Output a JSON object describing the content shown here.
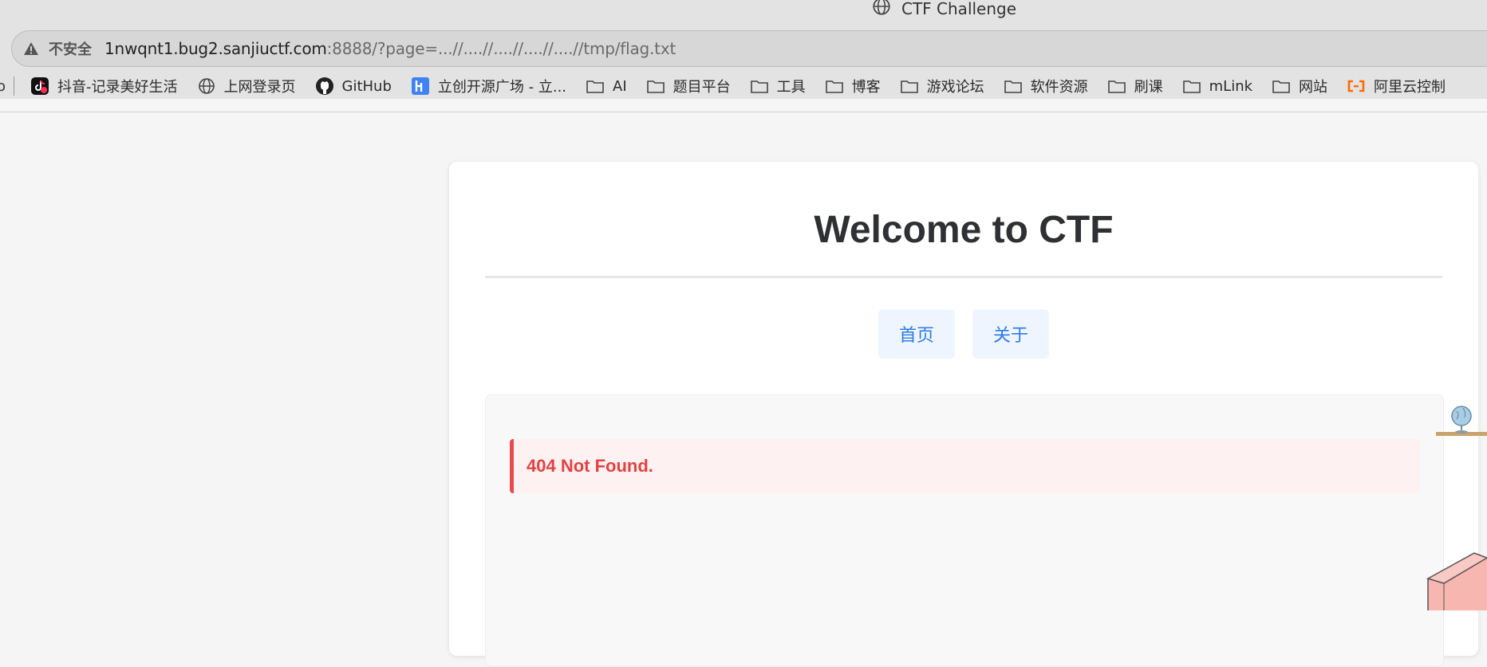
{
  "browser": {
    "tab_title": "CTF Challenge",
    "security_label": "不安全",
    "url_host": "1nwqnt1.bug2.sanjiuctf.com",
    "url_rest": ":8888/?page=...//....//....//....//....//tmp/flag.txt",
    "bookmarks_cut_left": "o",
    "bookmarks": [
      {
        "label": "抖音-记录美好生活",
        "icon": "douyin-icon"
      },
      {
        "label": "上网登录页",
        "icon": "globe-icon"
      },
      {
        "label": "GitHub",
        "icon": "github-icon"
      },
      {
        "label": "立创开源广场 - 立...",
        "icon": "oshwhub-icon"
      },
      {
        "label": "AI",
        "icon": "folder-icon"
      },
      {
        "label": "题目平台",
        "icon": "folder-icon"
      },
      {
        "label": "工具",
        "icon": "folder-icon"
      },
      {
        "label": "博客",
        "icon": "folder-icon"
      },
      {
        "label": "游戏论坛",
        "icon": "folder-icon"
      },
      {
        "label": "软件资源",
        "icon": "folder-icon"
      },
      {
        "label": "刷课",
        "icon": "folder-icon"
      },
      {
        "label": "mLink",
        "icon": "folder-icon"
      },
      {
        "label": "网站",
        "icon": "folder-icon"
      },
      {
        "label": "阿里云控制",
        "icon": "aliyun-icon"
      }
    ]
  },
  "page": {
    "title": "Welcome to CTF",
    "nav": [
      {
        "label": "首页"
      },
      {
        "label": "关于"
      }
    ],
    "error_message": "404 Not Found."
  },
  "colors": {
    "accent": "#2f7be3",
    "error": "#e24242",
    "error_bg": "#fdf1f1"
  }
}
